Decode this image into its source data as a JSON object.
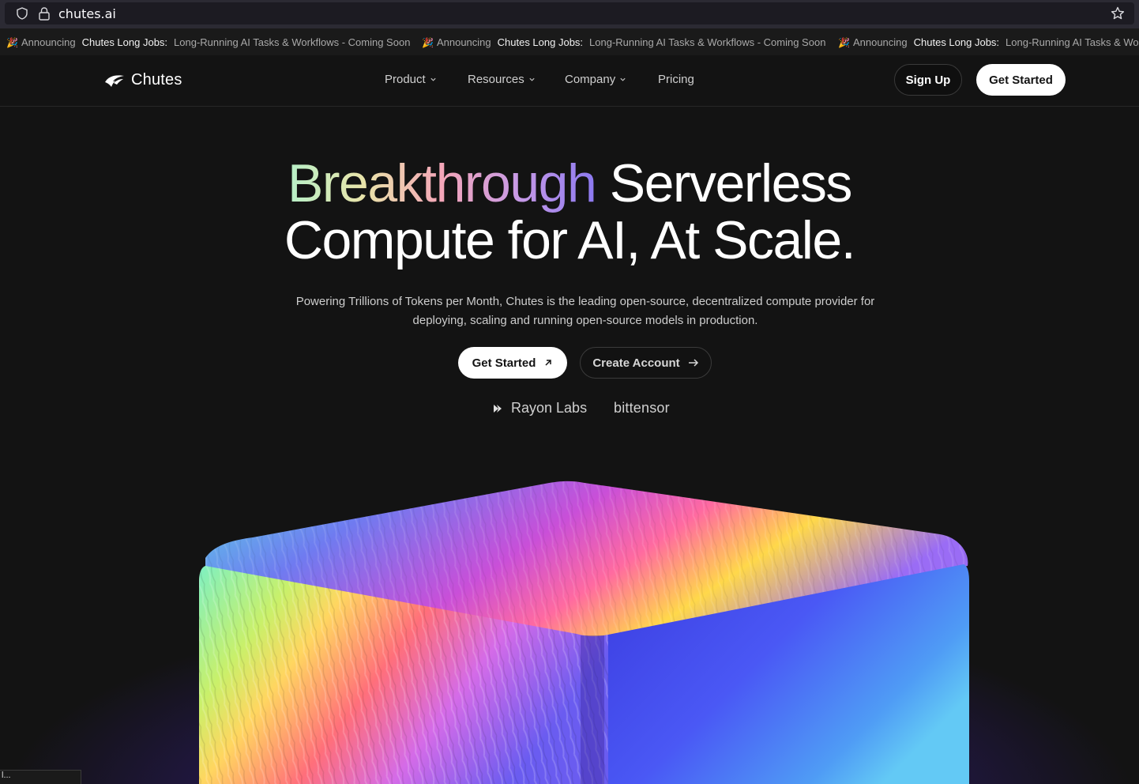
{
  "browser": {
    "url": "chutes.ai"
  },
  "announcement": {
    "prefix": "Announcing",
    "title": "Chutes Long Jobs:",
    "description": "Long-Running AI Tasks & Workflows - Coming Soon",
    "description_cut": "Long-Running AI Tasks & Workf"
  },
  "nav": {
    "brand": "Chutes",
    "items": [
      {
        "label": "Product"
      },
      {
        "label": "Resources"
      },
      {
        "label": "Company"
      },
      {
        "label": "Pricing"
      }
    ],
    "signup_label": "Sign Up",
    "get_started_label": "Get Started"
  },
  "hero": {
    "title_highlight": "Breakthrough",
    "title_rest_line1": "Serverless",
    "title_line2": "Compute for AI, At Scale.",
    "subtitle": "Powering Trillions of Tokens per Month, Chutes is the leading open-source, decentralized compute provider for deploying, scaling and running open-source models in production.",
    "primary_cta": "Get Started",
    "secondary_cta": "Create Account",
    "partners": [
      "Rayon Labs",
      "bittensor"
    ]
  },
  "status_bar": {
    "text": "l..."
  }
}
